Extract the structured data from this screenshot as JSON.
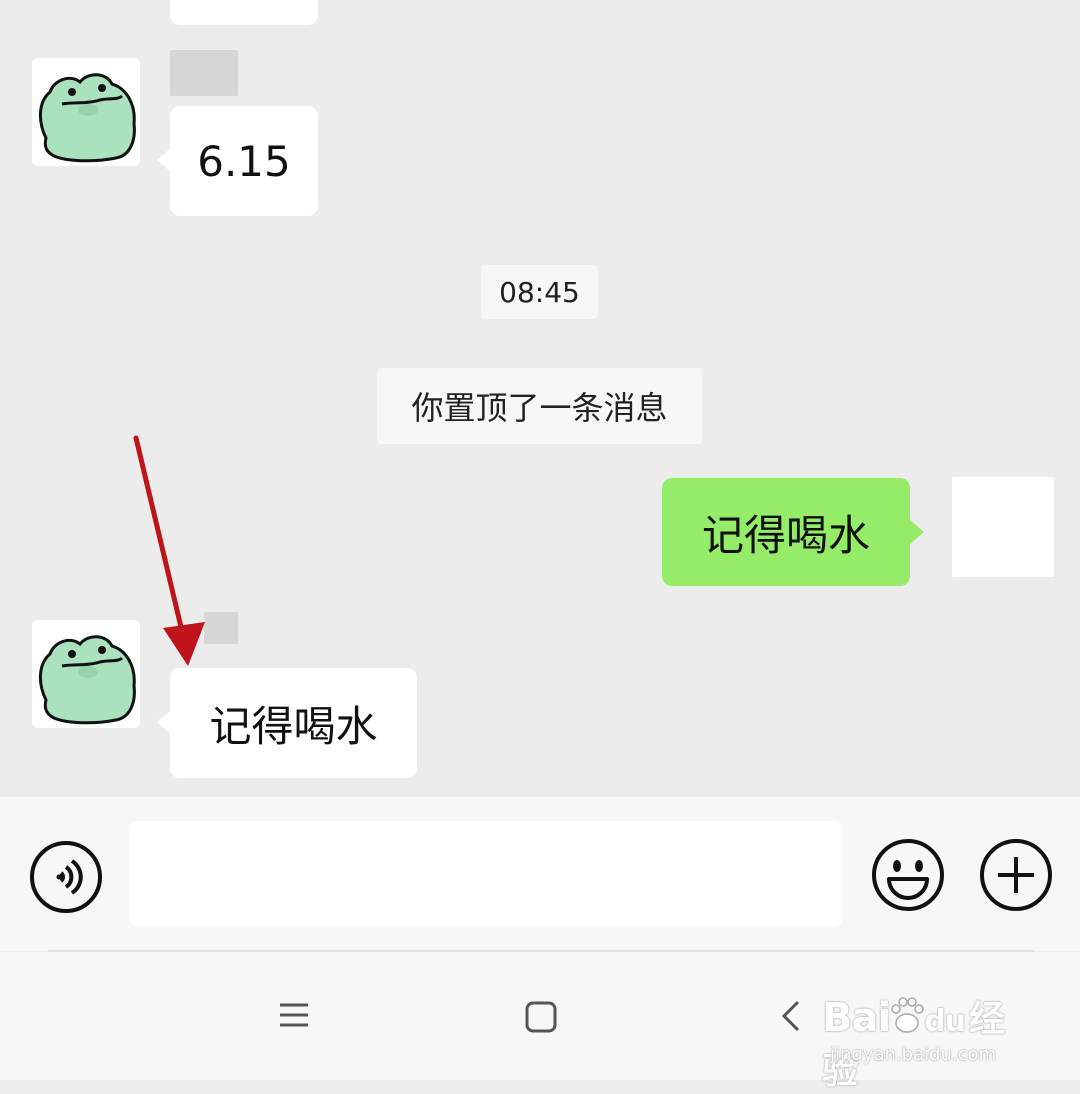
{
  "messages": {
    "received_1": "6.15",
    "timestamp": "08:45",
    "system_notice": "你置顶了一条消息",
    "sent_1": "记得喝水",
    "received_2": "记得喝水"
  },
  "watermark": {
    "brand": "Bai",
    "brand_suffix": "du",
    "jingyan": "经验",
    "url": "jingyan.baidu.com"
  },
  "icons": {
    "voice": "voice-toggle-icon",
    "emoji": "emoji-icon",
    "plus": "plus-icon",
    "menu": "nav-menu-icon",
    "home": "nav-home-icon",
    "back": "nav-back-icon"
  },
  "colors": {
    "chat_bg": "#ececec",
    "sent_bubble": "#95ec69",
    "received_bubble": "#ffffff",
    "annotation_arrow": "#c0141b",
    "avatar_frog": "#a9e2bc"
  }
}
